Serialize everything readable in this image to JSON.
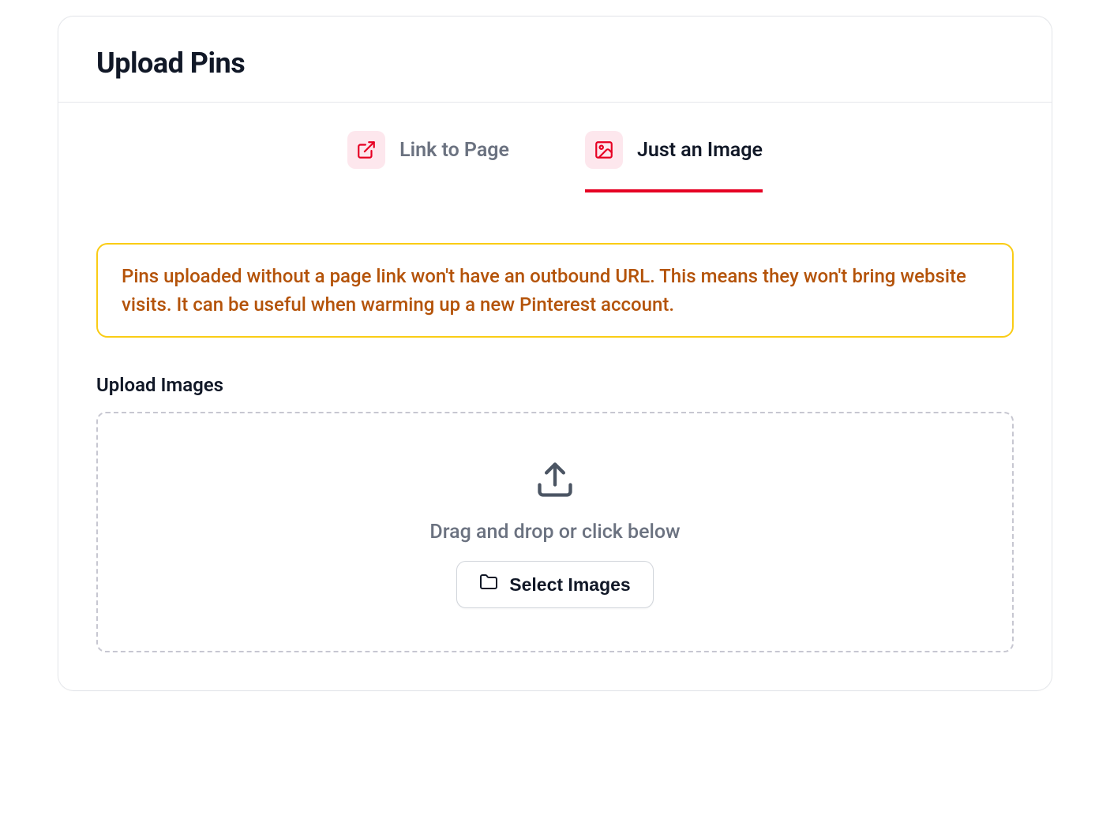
{
  "header": {
    "title": "Upload Pins"
  },
  "tabs": {
    "link": {
      "label": "Link to Page",
      "icon": "external-link-icon"
    },
    "image": {
      "label": "Just an Image",
      "icon": "image-icon"
    },
    "active": "image"
  },
  "alert": {
    "text": "Pins uploaded without a page link won't have an outbound URL. This means they won't bring website visits. It can be useful when warming up a new Pinterest account."
  },
  "upload": {
    "section_label": "Upload Images",
    "drop_text": "Drag and drop or click below",
    "button_label": "Select Images"
  },
  "colors": {
    "accent": "#e60023",
    "warning_border": "#facc15",
    "warning_text": "#b45309"
  }
}
